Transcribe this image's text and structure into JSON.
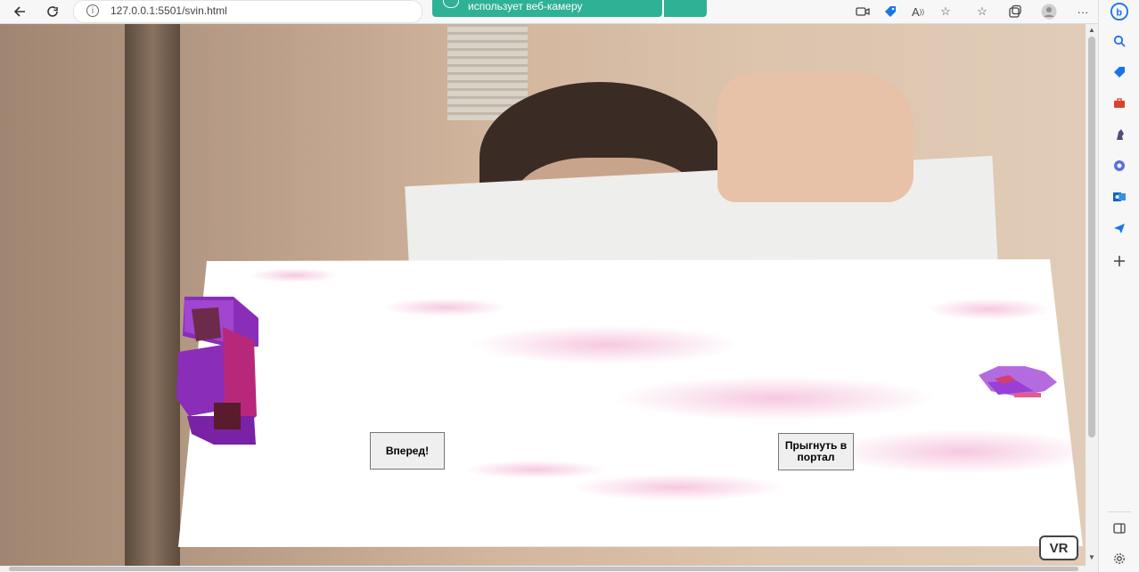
{
  "browser": {
    "url": "127.0.0.1:5501/svin.html",
    "camera_banner": "использует веб-камеру"
  },
  "ar": {
    "forward_label": "Вперед!",
    "portal_label": "Прыгнуть в портал",
    "vr_label": "VR"
  },
  "colors": {
    "banner": "#2fb195",
    "pig_dark": "#8a2db8",
    "pig_light": "#b46be0",
    "plane_pink": "#f4c6e0"
  }
}
